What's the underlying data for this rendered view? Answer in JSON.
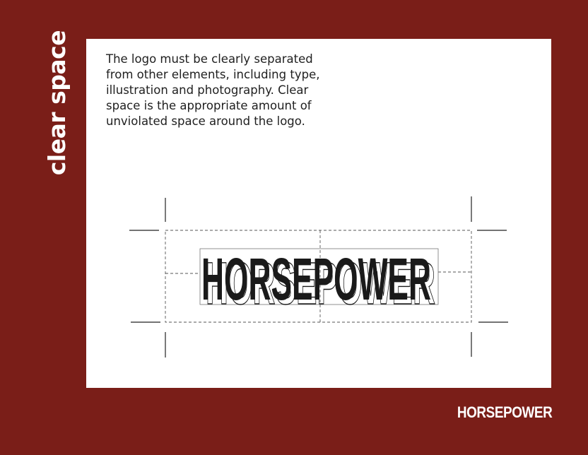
{
  "section_title": "clear space",
  "description": "The logo must be clearly separated from other elements, including type, illustration and photography. Clear space is the appropriate amount of unviolated space around the logo.",
  "logo_text": "HORSEPOWER",
  "footer_logo": "HORSEPOWER",
  "colors": {
    "background": "#7a1e18",
    "panel": "#ffffff",
    "logo_ink": "#1a1a1a"
  }
}
